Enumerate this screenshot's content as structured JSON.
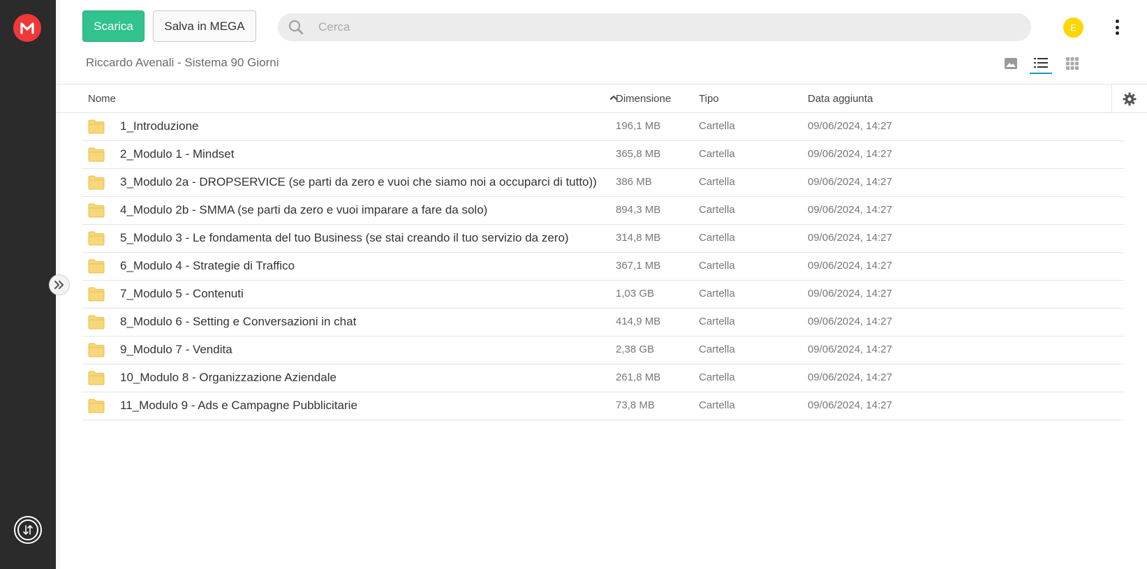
{
  "sidebar": {
    "logo_letter": "M",
    "logo_color": "#f0373a",
    "transfer_icon": "transfer-manager-icon",
    "expand_icon": "double-chevron-right-icon"
  },
  "toolbar": {
    "download_label": "Scarica",
    "save_label": "Salva in MEGA",
    "search_placeholder": "Cerca",
    "avatar_letter": "E",
    "avatar_color": "#ffd600"
  },
  "breadcrumb": "Riccardo Avenali - Sistema 90 Giorni",
  "view_modes": [
    "media-view-icon",
    "list-view-icon",
    "grid-view-icon"
  ],
  "active_view": "list",
  "table": {
    "headers": {
      "name": "Nome",
      "size": "Dimensione",
      "type": "Tipo",
      "date": "Data aggiunta"
    },
    "rows": [
      {
        "name": "1_Introduzione",
        "size": "196,1 MB",
        "type": "Cartella",
        "date": "09/06/2024, 14:27"
      },
      {
        "name": "2_Modulo 1 - Mindset",
        "size": "365,8 MB",
        "type": "Cartella",
        "date": "09/06/2024, 14:27"
      },
      {
        "name": "3_Modulo 2a - DROPSERVICE (se parti da zero e vuoi che siamo noi a occuparci di tutto))",
        "size": "386 MB",
        "type": "Cartella",
        "date": "09/06/2024, 14:27"
      },
      {
        "name": "4_Modulo 2b - SMMA (se parti da zero e vuoi imparare a fare da solo)",
        "size": "894,3 MB",
        "type": "Cartella",
        "date": "09/06/2024, 14:27"
      },
      {
        "name": "5_Modulo 3 - Le fondamenta del tuo Business (se stai creando il tuo servizio da zero)",
        "size": "314,8 MB",
        "type": "Cartella",
        "date": "09/06/2024, 14:27"
      },
      {
        "name": "6_Modulo 4 - Strategie di Traffico",
        "size": "367,1 MB",
        "type": "Cartella",
        "date": "09/06/2024, 14:27"
      },
      {
        "name": "7_Modulo 5 - Contenuti",
        "size": "1,03 GB",
        "type": "Cartella",
        "date": "09/06/2024, 14:27"
      },
      {
        "name": "8_Modulo 6 - Setting e Conversazioni in chat",
        "size": "414,9 MB",
        "type": "Cartella",
        "date": "09/06/2024, 14:27"
      },
      {
        "name": "9_Modulo 7 - Vendita",
        "size": "2,38 GB",
        "type": "Cartella",
        "date": "09/06/2024, 14:27"
      },
      {
        "name": "10_Modulo 8 - Organizzazione Aziendale",
        "size": "261,8 MB",
        "type": "Cartella",
        "date": "09/06/2024, 14:27"
      },
      {
        "name": "11_Modulo 9 - Ads e Campagne Pubblicitarie",
        "size": "73,8 MB",
        "type": "Cartella",
        "date": "09/06/2024, 14:27"
      }
    ]
  }
}
